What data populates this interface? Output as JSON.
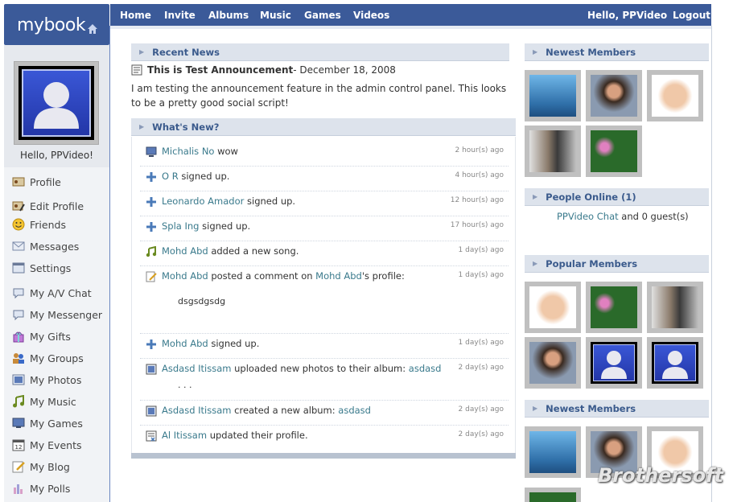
{
  "brand": {
    "logo": "mybook"
  },
  "nav": {
    "items": [
      "Home",
      "Invite",
      "Albums",
      "Music",
      "Games",
      "Videos"
    ],
    "greeting": "Hello, PPVideo",
    "logout": "Logout"
  },
  "sidebar": {
    "hello": "Hello, PPVideo!",
    "items": [
      {
        "label": "Profile",
        "icon": "profile-card-icon"
      },
      {
        "label": "Edit Profile",
        "icon": "edit-profile-icon"
      },
      {
        "label": "Friends",
        "icon": "smiley-icon"
      },
      {
        "label": "Messages",
        "icon": "envelope-icon"
      },
      {
        "label": "Settings",
        "icon": "settings-window-icon"
      },
      {
        "label": "My A/V Chat",
        "icon": "chat-bubble-icon"
      },
      {
        "label": "My Messenger",
        "icon": "chat-bubble-icon"
      },
      {
        "label": "My Gifts",
        "icon": "gift-icon"
      },
      {
        "label": "My Groups",
        "icon": "group-icon"
      },
      {
        "label": "My Photos",
        "icon": "photo-icon"
      },
      {
        "label": "My Music",
        "icon": "music-note-icon"
      },
      {
        "label": "My Games",
        "icon": "monitor-icon"
      },
      {
        "label": "My Events",
        "icon": "calendar-icon"
      },
      {
        "label": "My Blog",
        "icon": "pencil-note-icon"
      },
      {
        "label": "My Polls",
        "icon": "bar-chart-icon"
      }
    ]
  },
  "recent_news": {
    "heading": "Recent News",
    "title": "This is Test Announcement",
    "date": " - December 18, 2008",
    "body": "I am testing the announcement feature in the admin control panel. This looks to be a pretty good social script!"
  },
  "whats_new": {
    "heading": "What's New?",
    "items": [
      {
        "icon": "monitor-icon",
        "user": "Michalis No",
        "text": " wow",
        "time": "2 hour(s) ago"
      },
      {
        "icon": "plus-icon",
        "user": "O R",
        "text": " signed up.",
        "time": "4 hour(s) ago"
      },
      {
        "icon": "plus-icon",
        "user": "Leonardo Amador",
        "text": " signed up.",
        "time": "12 hour(s) ago"
      },
      {
        "icon": "plus-icon",
        "user": "Spla Ing",
        "text": " signed up.",
        "time": "17 hour(s) ago"
      },
      {
        "icon": "music-note-icon",
        "user": "Mohd Abd",
        "text": " added a new song.",
        "time": "1 day(s) ago"
      },
      {
        "icon": "pencil-note-icon",
        "user": "Mohd Abd",
        "text": " posted a comment on ",
        "link": "Mohd Abd",
        "text2": "'s profile:",
        "extra": "dsgsdgsdg",
        "time": "1 day(s) ago"
      },
      {
        "icon": "plus-icon",
        "user": "Mohd Abd",
        "text": " signed up.",
        "time": "1 day(s) ago"
      },
      {
        "icon": "photo-icon",
        "user": "Asdasd Itissam",
        "text": " uploaded new photos to their album: ",
        "link": "asdasd",
        "extra": ". . .",
        "time": "2 day(s) ago"
      },
      {
        "icon": "photo-icon",
        "user": "Asdasd Itissam",
        "text": " created a new album: ",
        "link": "asdasd",
        "time": "2 day(s) ago"
      },
      {
        "icon": "profile-update-icon",
        "user": "Al Itissam",
        "text": " updated their profile.",
        "time": "2 day(s) ago"
      }
    ]
  },
  "right": {
    "newest_heading": "Newest Members",
    "online_heading": "People Online (1)",
    "online_user": "PPVideo Chat",
    "online_rest": " and 0 guest(s)",
    "popular_heading": "Popular Members",
    "newest2_heading": "Newest Members"
  },
  "watermark": "Brothersoft",
  "colors": {
    "nav": "#3b5a99",
    "link": "#3a7a8c",
    "panel_head": "#dde3ec"
  }
}
